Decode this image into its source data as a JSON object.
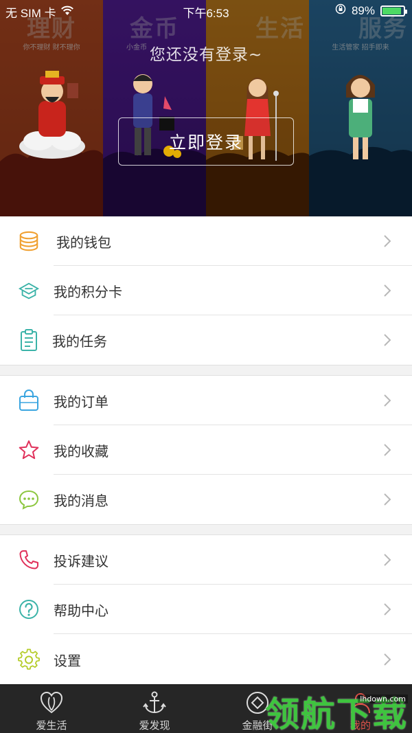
{
  "status_bar": {
    "carrier": "无 SIM 卡",
    "time": "下午6:53",
    "battery": "89%",
    "battery_level": 0.89
  },
  "banner": {
    "panels": [
      {
        "title": "理财",
        "subtitle": "你不理财 财不理你",
        "color": "#c8502a"
      },
      {
        "title": "金币",
        "subtitle": "小金币",
        "color": "#5a1fa0"
      },
      {
        "title": "生活",
        "subtitle": "",
        "color": "#d88a1c"
      },
      {
        "title": "服务",
        "subtitle": "生活管家 招手即来",
        "color": "#2b6c9c"
      }
    ],
    "prompt": "您还没有登录~",
    "login_button": "立即登录"
  },
  "menu": {
    "groups": [
      [
        {
          "label": "我的钱包",
          "icon": "wallet-coins-icon"
        },
        {
          "label": "我的积分卡",
          "icon": "points-card-icon"
        },
        {
          "label": "我的任务",
          "icon": "clipboard-task-icon"
        }
      ],
      [
        {
          "label": "我的订单",
          "icon": "shopping-bag-icon"
        },
        {
          "label": "我的收藏",
          "icon": "star-icon"
        },
        {
          "label": "我的消息",
          "icon": "chat-bubble-icon"
        }
      ],
      [
        {
          "label": "投诉建议",
          "icon": "phone-icon"
        },
        {
          "label": "帮助中心",
          "icon": "help-circle-icon"
        },
        {
          "label": "设置",
          "icon": "gear-icon"
        }
      ]
    ]
  },
  "tab_bar": {
    "tabs": [
      {
        "label": "爱生活",
        "icon": "leaf-heart-icon"
      },
      {
        "label": "爱发现",
        "icon": "anchor-icon"
      },
      {
        "label": "金融街",
        "icon": "diamond-coin-icon"
      },
      {
        "label": "我的",
        "icon": "profile-icon",
        "active": true
      }
    ]
  },
  "watermark": {
    "text": "领航下载",
    "url": "lhdown.com"
  },
  "colors": {
    "wallet": "#f0a030",
    "points": "#3bb3a8",
    "task": "#3bb3a8",
    "bag": "#3aa5e0",
    "star": "#e0305a",
    "chat": "#8cc63f",
    "phone": "#e0305a",
    "help": "#3bb3a8",
    "gear": "#b5cc2a",
    "tab_active": "#e0534a"
  }
}
